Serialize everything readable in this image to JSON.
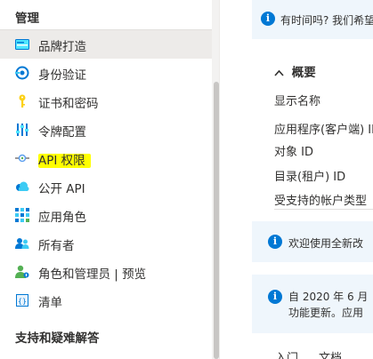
{
  "sidebar": {
    "section_manage": "管理",
    "section_support": "支持和疑难解答",
    "items": [
      {
        "label": "品牌打造",
        "icon": "branding-icon",
        "selected": true
      },
      {
        "label": "身份验证",
        "icon": "authentication-icon",
        "selected": false
      },
      {
        "label": "证书和密码",
        "icon": "key-icon",
        "selected": false
      },
      {
        "label": "令牌配置",
        "icon": "token-configuration-icon",
        "selected": false
      },
      {
        "label": "API 权限",
        "icon": "api-permissions-icon",
        "selected": false,
        "highlighted": true
      },
      {
        "label": "公开 API",
        "icon": "cloud-icon",
        "selected": false
      },
      {
        "label": "应用角色",
        "icon": "app-roles-grid-icon",
        "selected": false
      },
      {
        "label": "所有者",
        "icon": "owners-icon",
        "selected": false
      },
      {
        "label": "角色和管理员 | 预览",
        "icon": "roles-admins-icon",
        "selected": false
      },
      {
        "label": "清单",
        "icon": "manifest-icon",
        "selected": false
      }
    ]
  },
  "main": {
    "top_info": "有时间吗? 我们希望",
    "overview_label": "概要",
    "properties": [
      "显示名称",
      "应用程序(客户端) ID",
      "对象 ID",
      "目录(租户) ID",
      "受支持的帐户类型"
    ],
    "info_welcome": "欢迎使用全新改",
    "info_update_line1": "自 2020 年 6 月",
    "info_update_line2": "功能更新。应用",
    "tabs": [
      "入门",
      "文档"
    ]
  },
  "colors": {
    "accent": "#0078d4",
    "selected_bg": "#edebe9",
    "highlight": "#ffff00",
    "info_bg": "#eff6fc"
  }
}
